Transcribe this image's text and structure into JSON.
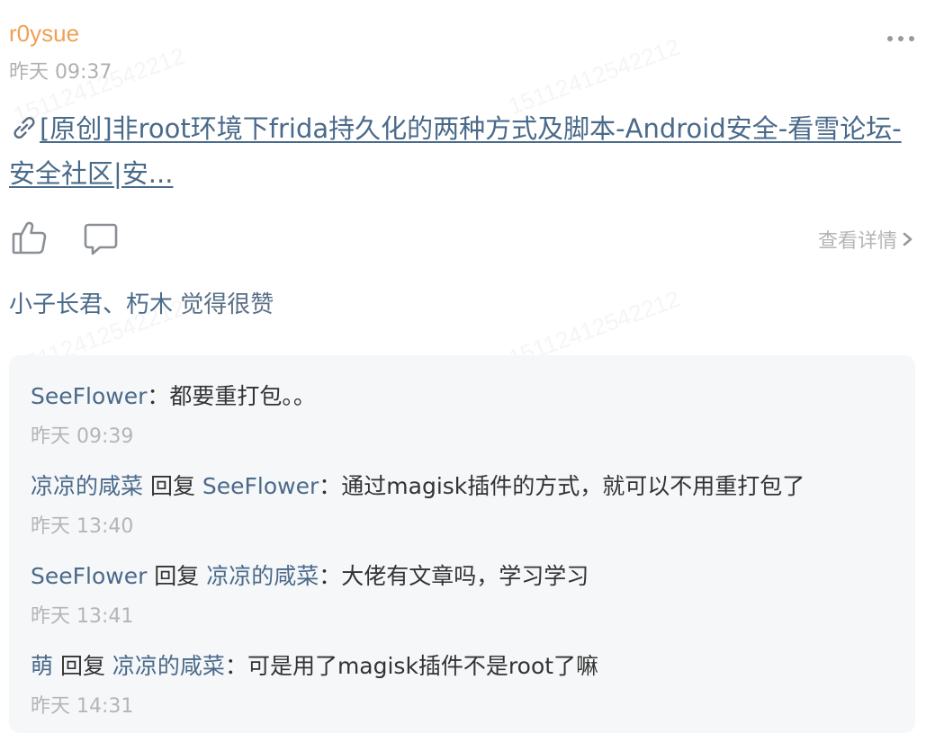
{
  "post": {
    "author": "r0ysue",
    "time": "昨天 09:37",
    "link_text": "[原创]非root环境下frida持久化的两种方式及脚本-Android安全-看雪论坛-安全社区|安...",
    "detail_label": "查看详情",
    "likes_names": "小子长君、朽木",
    "likes_suffix": " 觉得很赞"
  },
  "watermark": "15112412542212",
  "comments": [
    {
      "user": "SeeFlower",
      "reply_word": "",
      "reply_to": "",
      "text": "：都要重打包。。",
      "time": "昨天 09:39"
    },
    {
      "user": "凉凉的咸菜",
      "reply_word": " 回复 ",
      "reply_to": "SeeFlower",
      "text": "：通过magisk插件的方式，就可以不用重打包了",
      "time": "昨天 13:40"
    },
    {
      "user": "SeeFlower",
      "reply_word": " 回复 ",
      "reply_to": "凉凉的咸菜",
      "text": "：大佬有文章吗，学习学习",
      "time": "昨天 13:41"
    },
    {
      "user": "萌",
      "reply_word": " 回复 ",
      "reply_to": "凉凉的咸菜",
      "text": "：可是用了magisk插件不是root了嘛",
      "time": "昨天 14:31"
    }
  ],
  "icons": {
    "more": "more-dots-icon",
    "link": "link-icon",
    "like": "thumbs-up-icon",
    "comment": "comment-bubble-icon",
    "chevron": "chevron-right-icon"
  },
  "colors": {
    "author": "#f0a055",
    "link": "#4a6a8a",
    "muted": "#b5b5b5",
    "comment_bg": "#f6f7f9"
  }
}
